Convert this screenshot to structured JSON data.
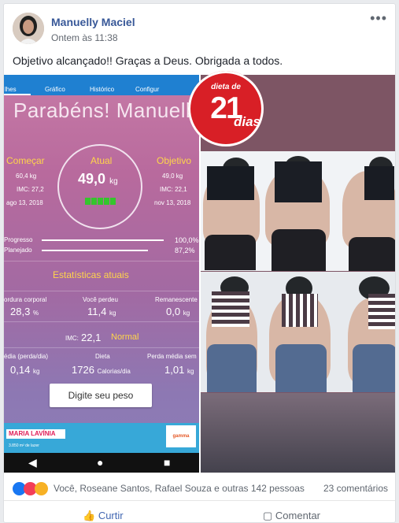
{
  "post": {
    "author": "Manuelly Maciel",
    "timestamp": "Ontem às 11:38",
    "text": "Objetivo alcançado!! Graças a Deus. Obrigada a todos.",
    "more": "•••",
    "colors": {
      "link": "#385898",
      "brand": "#d81f26"
    }
  },
  "app": {
    "tabs": [
      "lhes",
      "Gráfico",
      "Histórico",
      "Configur"
    ],
    "title": "Parabéns! Manuelly",
    "start": {
      "label": "Começar",
      "weight": "60,4 kg",
      "imc": "IMC: 27,2",
      "date": "ago 13, 2018"
    },
    "current": {
      "label": "Atual",
      "weight": "49,0",
      "unit": "kg"
    },
    "goal": {
      "label": "Objetivo",
      "weight": "49,0 kg",
      "imc": "IMC: 22,1",
      "date": "nov 13, 2018"
    },
    "progress": {
      "label": "Progresso",
      "value": "100,0%",
      "level": 1.0
    },
    "planned": {
      "label": "Planejado",
      "value": "87,2%",
      "level": 0.872
    },
    "stats_title": "Estatísticas atuais",
    "body_fat": {
      "label": "ordura corporal",
      "value": "28,3",
      "unit": "%"
    },
    "lost": {
      "label": "Você perdeu",
      "value": "11,4",
      "unit": "kg"
    },
    "remaining": {
      "label": "Remanescente",
      "value": "0,0",
      "unit": "kg"
    },
    "imc": {
      "label": "IMC:",
      "value": "22,1",
      "status": "Normal"
    },
    "daily_loss": {
      "label": "édia (perda/dia)",
      "value": "0,14",
      "unit": "kg"
    },
    "diet": {
      "label": "Dieta",
      "value": "1726",
      "unit": "Calorias/dia"
    },
    "weekly": {
      "label": "Perda média sem",
      "value": "1,01",
      "unit": "kg"
    },
    "button": "Digite seu peso",
    "ad_title": "MARIA LAVÍNIA",
    "ad_text": "3.850 m² de lazer",
    "ad_brand": "gamma",
    "nav": [
      "◀",
      "●",
      "■"
    ]
  },
  "logo": {
    "top": "dieta de",
    "number": "21",
    "word": "dias"
  },
  "footer": {
    "reactions": "Você, Roseane Santos, Rafael Souza e outras 142 pessoas",
    "comments": "23 comentários",
    "like": "Curtir",
    "comment": "Comentar"
  }
}
